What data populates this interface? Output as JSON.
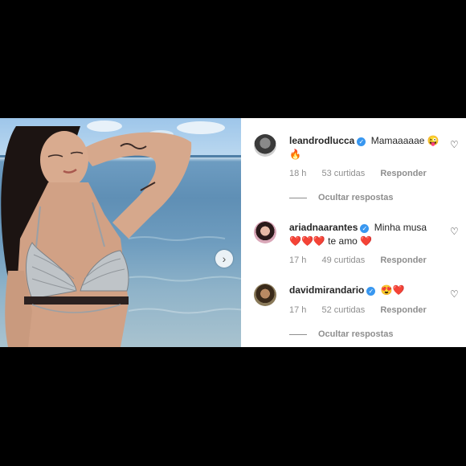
{
  "post": {
    "next_arrow": "›"
  },
  "comments": [
    {
      "username": "leandrodlucca",
      "text": "Mamaaaaae",
      "emojis": "😜 🔥",
      "time": "18 h",
      "likes": "53 curtidas",
      "reply": "Responder",
      "avatar_icon": "avatar-icon"
    },
    {
      "username": "ariadnaarantes",
      "text_line1": "Minha musa",
      "hearts1": "❤️❤️❤️",
      "text_line2": "te amo",
      "hearts2": "❤️",
      "time": "17 h",
      "likes": "49 curtidas",
      "reply": "Responder",
      "avatar_icon": "avatar-icon"
    },
    {
      "username": "davidmirandario",
      "emojis": "😍❤️",
      "time": "17 h",
      "likes": "52 curtidas",
      "reply": "Responder",
      "avatar_icon": "avatar-icon"
    }
  ],
  "hide_replies": "Ocultar respostas",
  "like_icon": "♡",
  "verified_badge": "✓",
  "colors": {
    "background": "#000000",
    "panel": "#ffffff",
    "verified": "#3897f0",
    "meta_text": "#8e8e8e",
    "primary_text": "#262626"
  }
}
